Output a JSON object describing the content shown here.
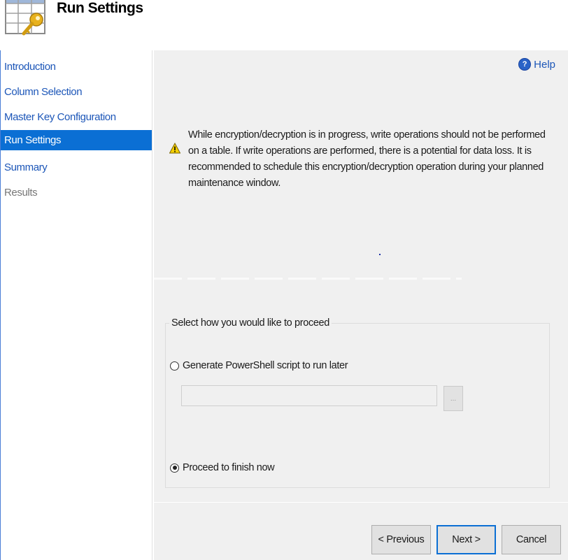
{
  "header": {
    "title": "Run Settings",
    "icon": "table-key-icon"
  },
  "sidebar": {
    "items": [
      {
        "label": "Introduction",
        "state": "link"
      },
      {
        "label": "Column Selection",
        "state": "link"
      },
      {
        "label": "Master Key Configuration",
        "state": "link"
      },
      {
        "label": "Run Settings",
        "state": "active"
      },
      {
        "label": "Summary",
        "state": "link"
      },
      {
        "label": "Results",
        "state": "disabled"
      }
    ]
  },
  "help": {
    "label": "Help",
    "icon": "help-icon"
  },
  "warning": {
    "icon": "warning-icon",
    "text": "While encryption/decryption is in progress, write operations should not be performed on a table. If write operations are performed, there is a potential for data loss. It is recommended to schedule this encryption/decryption operation during your planned maintenance window."
  },
  "proceed": {
    "legend": "Select how you would like to proceed",
    "options": [
      {
        "label": "Generate PowerShell script to run later",
        "selected": false
      },
      {
        "label": "Proceed to finish now",
        "selected": true
      }
    ],
    "script_path_value": "",
    "browse_label": "..."
  },
  "footer": {
    "previous_label": "< Previous",
    "next_label": "Next >",
    "cancel_label": "Cancel"
  },
  "colors": {
    "accent": "#0b6fd4",
    "link": "#1c56b8",
    "panel_bg": "#f0f0f0"
  }
}
